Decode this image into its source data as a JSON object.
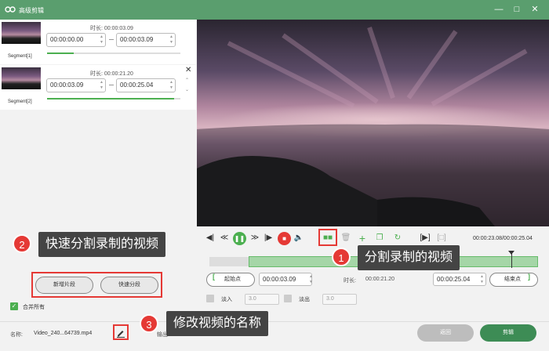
{
  "window": {
    "title": "高级剪辑",
    "minimize_icon": "minimize-icon",
    "maximize_icon": "maximize-icon",
    "close_icon": "close-icon"
  },
  "segments": [
    {
      "label": "Segment[1]",
      "duration_label": "时长:",
      "duration": "00:00:03.09",
      "start": "00:00:00.00",
      "end": "00:00:03.09",
      "progress": 0.2
    },
    {
      "label": "Segment[2]",
      "duration_label": "时长:",
      "duration": "00:00:21.20",
      "start": "00:00:03.09",
      "end": "00:00:25.04",
      "progress": 0.95
    }
  ],
  "left_buttons": {
    "add_segment": "新增片段",
    "quick_split": "快速分段"
  },
  "merge_all": {
    "label": "合并所有",
    "checked": true
  },
  "player": {
    "timecode": "00:00:23.08/00:00:25.04",
    "icons": [
      "prev-frame-icon",
      "step-back-icon",
      "play-pause-icon",
      "step-forward-icon",
      "next-frame-icon",
      "stop-icon",
      "volume-icon",
      "split-icon",
      "delete-icon",
      "add-icon",
      "copy-icon",
      "reset-icon",
      "fit-icon",
      "crop-icon"
    ]
  },
  "timeline": {
    "selection_start_fraction": 0.12,
    "playhead_fraction": 0.92
  },
  "trim": {
    "start_button": "起始点",
    "start_time": "00:00:03.09",
    "duration_label": "时长:",
    "duration": "00:00:21.20",
    "end_time": "00:00:25.04",
    "end_button": "结束点"
  },
  "fade": {
    "fade_in_label": "淡入",
    "fade_in_value": "3.0",
    "fade_out_label": "淡出",
    "fade_out_value": "3.0"
  },
  "bottom": {
    "name_label": "名称:",
    "name_value": "Video_240...64739.mp4",
    "output_label": "输出:",
    "output_value": "",
    "back_button": "返回",
    "edit_button": "剪辑"
  },
  "callouts": {
    "c1_number": "1",
    "c1_text": "分割录制的视频",
    "c2_number": "2",
    "c2_text": "快速分割录制的视频",
    "c3_number": "3",
    "c3_text": "修改视频的名称"
  },
  "colors": {
    "title_bar": "#5a9e6e",
    "accent_green": "#4caf50",
    "primary_button": "#3d8c55",
    "highlight_red": "#e53935",
    "callout_bg": "#444444"
  }
}
